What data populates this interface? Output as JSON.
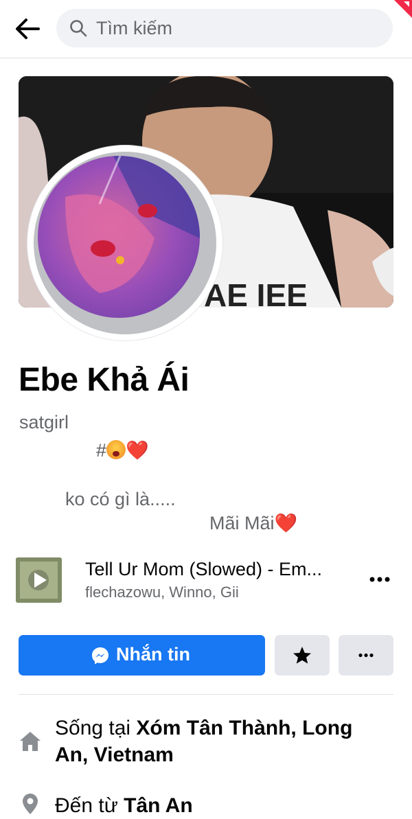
{
  "header": {
    "search_placeholder": "Tìm kiếm"
  },
  "profile": {
    "name": "Ebe Khả Ái",
    "bio": {
      "line1": "satgirl",
      "line2_prefix": "#",
      "line2_emojis": "❤️",
      "line3": "ko có gì là.....",
      "line4_text": "Mãi Mãi",
      "line4_heart": "❤️"
    }
  },
  "music": {
    "title": "Tell Ur Mom (Slowed) - Em...",
    "artist": "flechazowu, Winno, Gii"
  },
  "actions": {
    "message_label": "Nhắn tin"
  },
  "intro": {
    "lives_prefix": "Sống tại ",
    "lives_place": "Xóm Tân Thành, Long An, Vietnam",
    "from_prefix": "Đến từ ",
    "from_place": "Tân An"
  },
  "colors": {
    "accent": "#1877f2",
    "secondary_button": "#e4e6eb",
    "search_bg": "#f0f2f5",
    "muted_text": "#65676b"
  },
  "icons": {
    "back": "arrow-left-icon",
    "search": "search-icon",
    "message": "messenger-icon",
    "star": "star-icon",
    "more": "more-horizontal-icon",
    "home": "home-icon",
    "location": "location-pin-icon"
  }
}
